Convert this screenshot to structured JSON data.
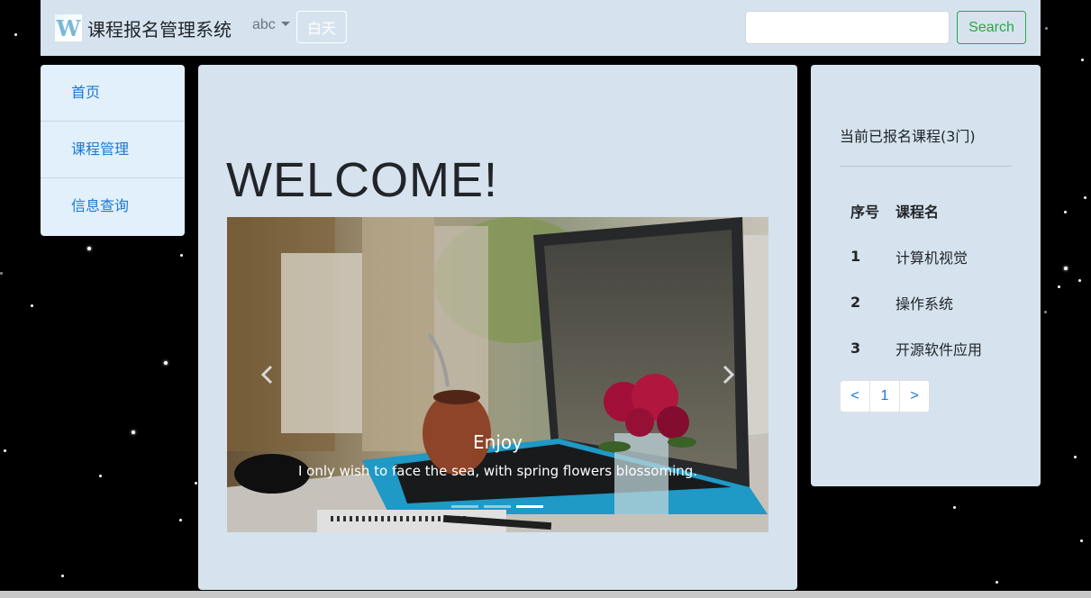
{
  "navbar": {
    "brand_logo_letter": "W",
    "brand_title": "课程报名管理系统",
    "dropdown_label": "abc",
    "day_button_label": "白天",
    "search_placeholder": "",
    "search_button_label": "Search"
  },
  "sidebar": {
    "items": [
      {
        "label": "首页"
      },
      {
        "label": "课程管理"
      },
      {
        "label": "信息查询"
      }
    ]
  },
  "main": {
    "heading": "WELCOME!",
    "carousel": {
      "caption_title": "Enjoy",
      "caption_text": "I only wish to face the sea, with spring flowers blossoming.",
      "slide_count": 3,
      "active_slide": 3,
      "prev_icon": "chevron-left-icon",
      "next_icon": "chevron-right-icon"
    }
  },
  "right_panel": {
    "title": "当前已报名课程(3门)",
    "table": {
      "headers": [
        "序号",
        "课程名"
      ],
      "rows": [
        [
          "1",
          "计算机视觉"
        ],
        [
          "2",
          "操作系统"
        ],
        [
          "3",
          "开源软件应用"
        ]
      ]
    },
    "pagination": [
      "<",
      "1",
      ">"
    ]
  },
  "colors": {
    "panel_bg": "#d6e3ee",
    "sidebar_bg": "#e2f0fc",
    "link": "#1c79d0",
    "success": "#28a745",
    "page_bg": "#000000"
  }
}
